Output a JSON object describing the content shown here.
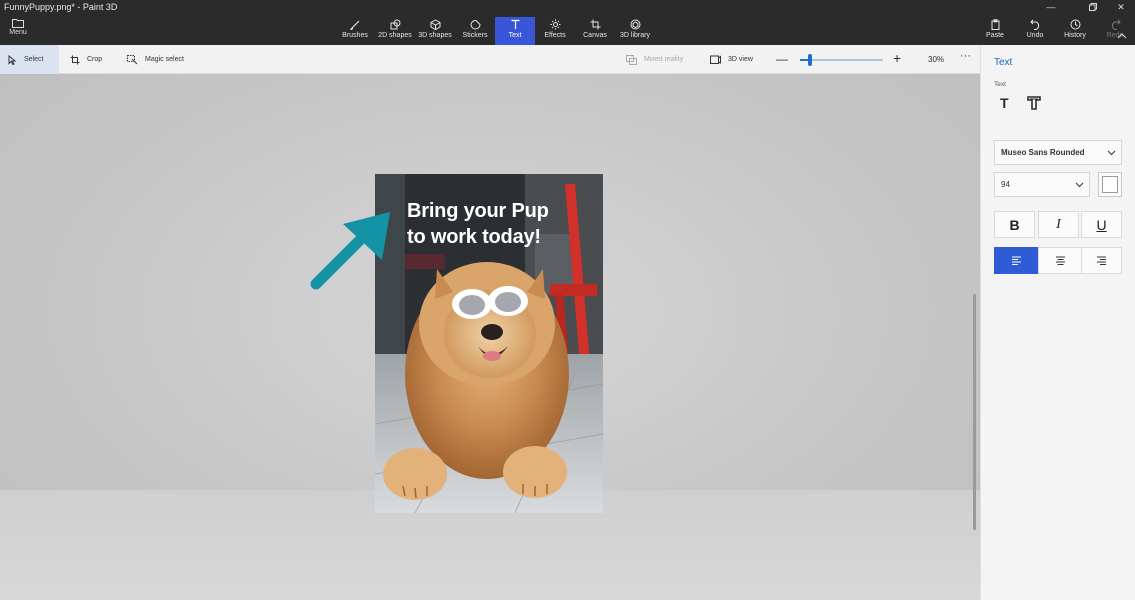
{
  "window": {
    "title": "FunnyPuppy.png* - Paint 3D"
  },
  "menu": {
    "label": "Menu"
  },
  "toolbar": {
    "tools": [
      {
        "label": "Brushes",
        "icon": "brush-icon"
      },
      {
        "label": "2D shapes",
        "icon": "shapes-2d-icon"
      },
      {
        "label": "3D shapes",
        "icon": "shapes-3d-icon"
      },
      {
        "label": "Stickers",
        "icon": "stickers-icon"
      },
      {
        "label": "Text",
        "icon": "text-icon",
        "active": true
      },
      {
        "label": "Effects",
        "icon": "effects-icon"
      },
      {
        "label": "Canvas",
        "icon": "canvas-icon"
      },
      {
        "label": "3D library",
        "icon": "library-3d-icon"
      }
    ],
    "right": [
      {
        "label": "Paste",
        "icon": "paste-icon"
      },
      {
        "label": "Undo",
        "icon": "undo-icon"
      },
      {
        "label": "History",
        "icon": "history-icon"
      },
      {
        "label": "Redo",
        "icon": "redo-icon",
        "disabled": true
      }
    ]
  },
  "subbar": {
    "select": "Select",
    "crop": "Crop",
    "magic_select": "Magic select",
    "mixed_reality": "Mixed reality",
    "view_3d": "3D view",
    "zoom": "30%",
    "zoom_slider_fraction": 0.12
  },
  "canvas": {
    "caption_line1": "Bring your Pup",
    "caption_line2": "to work today!"
  },
  "panel": {
    "title": "Text",
    "subtitle": "Text",
    "font": "Museo Sans Rounded",
    "size": "94",
    "color": "#ffffff",
    "alignment": "left"
  },
  "colors": {
    "accent": "#3a56d8",
    "arrow": "#1593a6"
  }
}
